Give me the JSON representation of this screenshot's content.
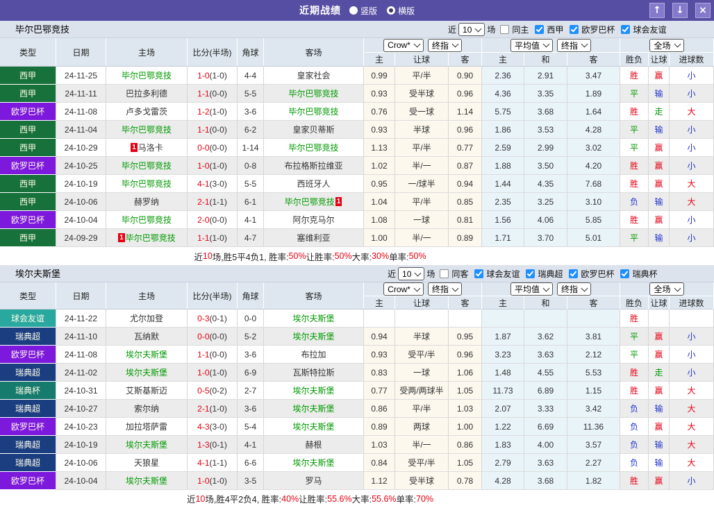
{
  "titlebar": {
    "title": "近期战绩",
    "radios": [
      {
        "label": "竖版",
        "selected": false
      },
      {
        "label": "横版",
        "selected": true
      }
    ],
    "buttons": [
      {
        "name": "scroll-up-button",
        "icon": "up-arrow-icon",
        "glyph": "↑"
      },
      {
        "name": "scroll-down-button",
        "icon": "down-arrow-icon",
        "glyph": "↓"
      },
      {
        "name": "close-button",
        "icon": "close-icon",
        "glyph": "×"
      }
    ]
  },
  "colors": {
    "titlebar_bg": "#564ea2",
    "button_bg": "#847acc",
    "filterbar_bg": "#dde3ed",
    "header_bg": "#dee7ef",
    "row_alt_bg": "#ececec",
    "handicap_col_bg": "#fdf8ee",
    "average_col_bg": "#e9f4f9",
    "self_team": "#009900",
    "score_red": "#e60012",
    "checkbox_blue": "#1f8fff"
  },
  "league_colors": {
    "西甲": "#17713a",
    "欧罗巴杯": "#7d18dd",
    "球会友谊": "#29a8a0",
    "瑞典超": "#1b3e80",
    "瑞典杯": "#167a6c"
  },
  "result_colors": {
    "胜": "red",
    "平": "green",
    "负": "blue",
    "赢": "red",
    "输": "blue",
    "走": "green",
    "大": "red",
    "小": "blue"
  },
  "columns": {
    "left": [
      "类型",
      "日期",
      "主场",
      "比分(半场)",
      "角球",
      "客场"
    ],
    "sub": [
      "主",
      "让球",
      "客",
      "主",
      "和",
      "客",
      "胜负",
      "让球",
      "进球数"
    ],
    "dropdown_groups": {
      "odds": [
        "Crow*",
        "终指"
      ],
      "average": [
        "平均值",
        "终指"
      ],
      "scope": [
        "全场"
      ]
    }
  },
  "panels": [
    {
      "team": "毕尔巴鄂竞技",
      "filter": {
        "near_label": "近",
        "count": "10",
        "games_label": "场",
        "same": {
          "label": "同主",
          "checked": false
        },
        "leagues": [
          {
            "label": "西甲",
            "checked": true
          },
          {
            "label": "欧罗巴杯",
            "checked": true
          },
          {
            "label": "球会友谊",
            "checked": true
          }
        ]
      },
      "rows": [
        {
          "league": "西甲",
          "date": "24-11-25",
          "home": {
            "name": "毕尔巴鄂竞技",
            "self": true
          },
          "score": "1-0",
          "half": "(1-0)",
          "corner": "4-4",
          "away": {
            "name": "皇家社会",
            "self": false
          },
          "odds": [
            "0.99",
            "平/半",
            "0.90"
          ],
          "avg": [
            "2.36",
            "2.91",
            "3.47"
          ],
          "res": [
            "胜",
            "赢",
            "小"
          ]
        },
        {
          "league": "西甲",
          "date": "24-11-11",
          "home": {
            "name": "巴拉多利德",
            "self": false
          },
          "score": "1-1",
          "half": "(0-0)",
          "corner": "5-5",
          "away": {
            "name": "毕尔巴鄂竞技",
            "self": true
          },
          "odds": [
            "0.93",
            "受半球",
            "0.96"
          ],
          "avg": [
            "4.36",
            "3.35",
            "1.89"
          ],
          "res": [
            "平",
            "输",
            "小"
          ]
        },
        {
          "league": "欧罗巴杯",
          "date": "24-11-08",
          "home": {
            "name": "卢多戈雷茨",
            "self": false
          },
          "score": "1-2",
          "half": "(1-0)",
          "corner": "3-6",
          "away": {
            "name": "毕尔巴鄂竞技",
            "self": true
          },
          "odds": [
            "0.76",
            "受一球",
            "1.14"
          ],
          "avg": [
            "5.75",
            "3.68",
            "1.64"
          ],
          "res": [
            "胜",
            "走",
            "大"
          ]
        },
        {
          "league": "西甲",
          "date": "24-11-04",
          "home": {
            "name": "毕尔巴鄂竞技",
            "self": true
          },
          "score": "1-1",
          "half": "(0-0)",
          "corner": "6-2",
          "away": {
            "name": "皇家贝蒂斯",
            "self": false
          },
          "odds": [
            "0.93",
            "半球",
            "0.96"
          ],
          "avg": [
            "1.86",
            "3.53",
            "4.28"
          ],
          "res": [
            "平",
            "输",
            "小"
          ]
        },
        {
          "league": "西甲",
          "date": "24-10-29",
          "home": {
            "name": "马洛卡",
            "self": false,
            "badge": "1",
            "badge_pos": "before"
          },
          "score": "0-0",
          "half": "(0-0)",
          "corner": "1-14",
          "away": {
            "name": "毕尔巴鄂竞技",
            "self": true
          },
          "odds": [
            "1.13",
            "平/半",
            "0.77"
          ],
          "avg": [
            "2.59",
            "2.99",
            "3.02"
          ],
          "res": [
            "平",
            "赢",
            "小"
          ]
        },
        {
          "league": "欧罗巴杯",
          "date": "24-10-25",
          "home": {
            "name": "毕尔巴鄂竞技",
            "self": true
          },
          "score": "1-0",
          "half": "(1-0)",
          "corner": "0-8",
          "away": {
            "name": "布拉格斯拉维亚",
            "self": false
          },
          "odds": [
            "1.02",
            "半/一",
            "0.87"
          ],
          "avg": [
            "1.88",
            "3.50",
            "4.20"
          ],
          "res": [
            "胜",
            "赢",
            "小"
          ]
        },
        {
          "league": "西甲",
          "date": "24-10-19",
          "home": {
            "name": "毕尔巴鄂竞技",
            "self": true
          },
          "score": "4-1",
          "half": "(3-0)",
          "corner": "5-5",
          "away": {
            "name": "西班牙人",
            "self": false
          },
          "odds": [
            "0.95",
            "一/球半",
            "0.94"
          ],
          "avg": [
            "1.44",
            "4.35",
            "7.68"
          ],
          "res": [
            "胜",
            "赢",
            "大"
          ]
        },
        {
          "league": "西甲",
          "date": "24-10-06",
          "home": {
            "name": "赫罗纳",
            "self": false
          },
          "score": "2-1",
          "half": "(1-1)",
          "corner": "6-1",
          "away": {
            "name": "毕尔巴鄂竞技",
            "self": true,
            "badge": "1",
            "badge_pos": "after"
          },
          "odds": [
            "1.04",
            "平/半",
            "0.85"
          ],
          "avg": [
            "2.35",
            "3.25",
            "3.10"
          ],
          "res": [
            "负",
            "输",
            "大"
          ]
        },
        {
          "league": "欧罗巴杯",
          "date": "24-10-04",
          "home": {
            "name": "毕尔巴鄂竞技",
            "self": true
          },
          "score": "2-0",
          "half": "(0-0)",
          "corner": "4-1",
          "away": {
            "name": "阿尔克马尔",
            "self": false
          },
          "odds": [
            "1.08",
            "一球",
            "0.81"
          ],
          "avg": [
            "1.56",
            "4.06",
            "5.85"
          ],
          "res": [
            "胜",
            "赢",
            "小"
          ]
        },
        {
          "league": "西甲",
          "date": "24-09-29",
          "home": {
            "name": "毕尔巴鄂竞技",
            "self": true,
            "badge": "1",
            "badge_pos": "before"
          },
          "score": "1-1",
          "half": "(1-0)",
          "corner": "4-7",
          "away": {
            "name": "塞维利亚",
            "self": false
          },
          "odds": [
            "1.00",
            "半/一",
            "0.89"
          ],
          "avg": [
            "1.71",
            "3.70",
            "5.01"
          ],
          "res": [
            "平",
            "输",
            "小"
          ]
        }
      ],
      "summary": [
        {
          "t": "近",
          "c": "k"
        },
        {
          "t": "10",
          "c": "r"
        },
        {
          "t": "场,胜5平4负1, 胜率:",
          "c": "k"
        },
        {
          "t": "50%",
          "c": "r"
        },
        {
          "t": " 让胜率:",
          "c": "k"
        },
        {
          "t": "50%",
          "c": "r"
        },
        {
          "t": " 大率:",
          "c": "k"
        },
        {
          "t": "30%",
          "c": "r"
        },
        {
          "t": " 单率:",
          "c": "k"
        },
        {
          "t": "50%",
          "c": "r"
        }
      ]
    },
    {
      "team": "埃尔夫斯堡",
      "filter": {
        "near_label": "近",
        "count": "10",
        "games_label": "场",
        "same": {
          "label": "同客",
          "checked": false
        },
        "leagues": [
          {
            "label": "球会友谊",
            "checked": true
          },
          {
            "label": "瑞典超",
            "checked": true
          },
          {
            "label": "欧罗巴杯",
            "checked": true
          },
          {
            "label": "瑞典杯",
            "checked": true
          }
        ]
      },
      "rows": [
        {
          "league": "球会友谊",
          "date": "24-11-22",
          "home": {
            "name": "尤尔加登",
            "self": false
          },
          "score": "0-3",
          "half": "(0-1)",
          "corner": "0-0",
          "away": {
            "name": "埃尔夫斯堡",
            "self": true
          },
          "odds": [
            "",
            "",
            ""
          ],
          "avg": [
            "",
            "",
            ""
          ],
          "res": [
            "胜",
            "",
            ""
          ]
        },
        {
          "league": "瑞典超",
          "date": "24-11-10",
          "home": {
            "name": "瓦纳默",
            "self": false
          },
          "score": "0-0",
          "half": "(0-0)",
          "corner": "5-2",
          "away": {
            "name": "埃尔夫斯堡",
            "self": true
          },
          "odds": [
            "0.94",
            "半球",
            "0.95"
          ],
          "avg": [
            "1.87",
            "3.62",
            "3.81"
          ],
          "res": [
            "平",
            "赢",
            "小"
          ]
        },
        {
          "league": "欧罗巴杯",
          "date": "24-11-08",
          "home": {
            "name": "埃尔夫斯堡",
            "self": true
          },
          "score": "1-1",
          "half": "(0-0)",
          "corner": "3-6",
          "away": {
            "name": "布拉加",
            "self": false
          },
          "odds": [
            "0.93",
            "受平/半",
            "0.96"
          ],
          "avg": [
            "3.23",
            "3.63",
            "2.12"
          ],
          "res": [
            "平",
            "赢",
            "小"
          ]
        },
        {
          "league": "瑞典超",
          "date": "24-11-02",
          "home": {
            "name": "埃尔夫斯堡",
            "self": true
          },
          "score": "1-0",
          "half": "(1-0)",
          "corner": "6-9",
          "away": {
            "name": "瓦斯特拉斯",
            "self": false
          },
          "odds": [
            "0.83",
            "一球",
            "1.06"
          ],
          "avg": [
            "1.48",
            "4.55",
            "5.53"
          ],
          "res": [
            "胜",
            "走",
            "小"
          ]
        },
        {
          "league": "瑞典杯",
          "date": "24-10-31",
          "home": {
            "name": "艾斯基斯迈",
            "self": false
          },
          "score": "0-5",
          "half": "(0-2)",
          "corner": "2-7",
          "away": {
            "name": "埃尔夫斯堡",
            "self": true
          },
          "odds": [
            "0.77",
            "受两/两球半",
            "1.05"
          ],
          "avg": [
            "11.73",
            "6.89",
            "1.15"
          ],
          "res": [
            "胜",
            "赢",
            "大"
          ]
        },
        {
          "league": "瑞典超",
          "date": "24-10-27",
          "home": {
            "name": "索尔纳",
            "self": false
          },
          "score": "2-1",
          "half": "(1-0)",
          "corner": "3-6",
          "away": {
            "name": "埃尔夫斯堡",
            "self": true
          },
          "odds": [
            "0.86",
            "平/半",
            "1.03"
          ],
          "avg": [
            "2.07",
            "3.33",
            "3.42"
          ],
          "res": [
            "负",
            "输",
            "大"
          ]
        },
        {
          "league": "欧罗巴杯",
          "date": "24-10-23",
          "home": {
            "name": "加拉塔萨雷",
            "self": false
          },
          "score": "4-3",
          "half": "(3-0)",
          "corner": "5-4",
          "away": {
            "name": "埃尔夫斯堡",
            "self": true
          },
          "odds": [
            "0.89",
            "两球",
            "1.00"
          ],
          "avg": [
            "1.22",
            "6.69",
            "11.36"
          ],
          "res": [
            "负",
            "赢",
            "大"
          ]
        },
        {
          "league": "瑞典超",
          "date": "24-10-19",
          "home": {
            "name": "埃尔夫斯堡",
            "self": true
          },
          "score": "1-3",
          "half": "(0-1)",
          "corner": "4-1",
          "away": {
            "name": "赫根",
            "self": false
          },
          "odds": [
            "1.03",
            "半/一",
            "0.86"
          ],
          "avg": [
            "1.83",
            "4.00",
            "3.57"
          ],
          "res": [
            "负",
            "输",
            "大"
          ]
        },
        {
          "league": "瑞典超",
          "date": "24-10-06",
          "home": {
            "name": "天狼星",
            "self": false
          },
          "score": "4-1",
          "half": "(1-1)",
          "corner": "6-6",
          "away": {
            "name": "埃尔夫斯堡",
            "self": true
          },
          "odds": [
            "0.84",
            "受平/半",
            "1.05"
          ],
          "avg": [
            "2.79",
            "3.63",
            "2.27"
          ],
          "res": [
            "负",
            "输",
            "大"
          ]
        },
        {
          "league": "欧罗巴杯",
          "date": "24-10-04",
          "home": {
            "name": "埃尔夫斯堡",
            "self": true
          },
          "score": "1-0",
          "half": "(1-0)",
          "corner": "3-5",
          "away": {
            "name": "罗马",
            "self": false
          },
          "odds": [
            "1.12",
            "受半球",
            "0.78"
          ],
          "avg": [
            "4.28",
            "3.68",
            "1.82"
          ],
          "res": [
            "胜",
            "赢",
            "小"
          ]
        }
      ],
      "summary": [
        {
          "t": "近",
          "c": "k"
        },
        {
          "t": "10",
          "c": "r"
        },
        {
          "t": "场,胜4平2负4, 胜率:",
          "c": "k"
        },
        {
          "t": "40%",
          "c": "r"
        },
        {
          "t": " 让胜率:",
          "c": "k"
        },
        {
          "t": "55.6%",
          "c": "r"
        },
        {
          "t": " 大率:",
          "c": "k"
        },
        {
          "t": "55.6%",
          "c": "r"
        },
        {
          "t": " 单率:",
          "c": "k"
        },
        {
          "t": "70%",
          "c": "r"
        }
      ]
    }
  ]
}
